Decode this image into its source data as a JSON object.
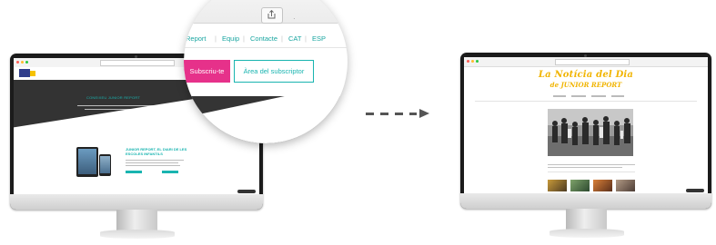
{
  "magnifier": {
    "nav_items": [
      "Report",
      "Equip",
      "Contacte",
      "CAT",
      "ESP"
    ],
    "separator": "|",
    "subscribe_label": "Subscriu-te",
    "subscriber_area_label": "Àrea del subscriptor",
    "icons": {
      "share": "share-icon"
    }
  },
  "left_screen": {
    "hero_title": "CONEIXEU JUNIOR REPORT",
    "product_title_line1": "JUNIOR REPORT, EL DIARI DE LES",
    "product_title_line2": "ESCOLES INFANTILS"
  },
  "right_screen": {
    "brand_line1": "La Notícia del Dia",
    "brand_line2": "de JUNIOR REPORT"
  },
  "colors": {
    "teal": "#19b4b0",
    "pink": "#e6318a",
    "yellow": "#f1b400",
    "dark": "#333333"
  }
}
